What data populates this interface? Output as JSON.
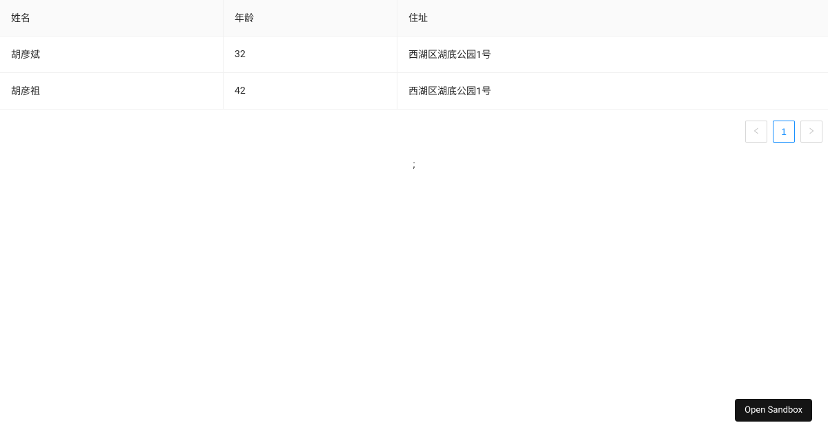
{
  "table": {
    "columns": [
      {
        "key": "name",
        "title": "姓名"
      },
      {
        "key": "age",
        "title": "年龄"
      },
      {
        "key": "address",
        "title": "住址"
      }
    ],
    "rows": [
      {
        "name": "胡彦斌",
        "age": "32",
        "address": "西湖区湖底公园1号"
      },
      {
        "name": "胡彦祖",
        "age": "42",
        "address": "西湖区湖底公园1号"
      }
    ]
  },
  "pagination": {
    "current": "1"
  },
  "stray": ";",
  "sandbox_button_label": "Open Sandbox"
}
